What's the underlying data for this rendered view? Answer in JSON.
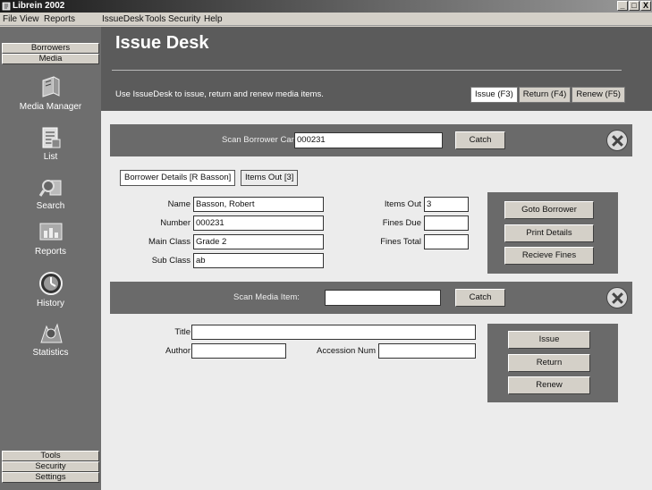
{
  "window": {
    "title": "Librein 2002",
    "minimize_glyph": "_",
    "maximize_glyph": "□",
    "close_glyph": "X"
  },
  "menubar": [
    "File",
    "View",
    "Reports",
    "IssueDesk",
    "Tools",
    "Security",
    "Help"
  ],
  "sidebar": {
    "top_groups": [
      "Borrowers",
      "Media"
    ],
    "items": [
      {
        "label": "Media Manager",
        "icon": "media-manager-icon"
      },
      {
        "label": "List",
        "icon": "list-icon"
      },
      {
        "label": "Search",
        "icon": "search-icon"
      },
      {
        "label": "Reports",
        "icon": "reports-icon"
      },
      {
        "label": "History",
        "icon": "history-icon"
      },
      {
        "label": "Statistics",
        "icon": "statistics-icon"
      }
    ],
    "bottom_groups": [
      "Tools",
      "Security",
      "Settings"
    ]
  },
  "header": {
    "title": "Issue Desk",
    "subtitle": "Use IssueDesk to issue, return and renew media items.",
    "tabs": [
      "Issue (F3)",
      "Return (F4)",
      "Renew (F5)"
    ],
    "active_tab": "Issue (F3)"
  },
  "borrower_scan": {
    "label": "Scan Borrower Card:",
    "value": "000231",
    "catch_label": "Catch"
  },
  "borrower_tabs": [
    "Borrower Details [R Basson]",
    "Items Out [3]"
  ],
  "borrower": {
    "name_label": "Name",
    "name": "Basson, Robert",
    "number_label": "Number",
    "number": "000231",
    "main_class_label": "Main Class",
    "main_class": "Grade 2",
    "sub_class_label": "Sub Class",
    "sub_class": "ab",
    "items_out_label": "Items Out",
    "items_out": "3",
    "fines_due_label": "Fines Due",
    "fines_due": "",
    "fines_total_label": "Fines Total",
    "fines_total": ""
  },
  "borrower_actions": [
    "Goto Borrower",
    "Print Details",
    "Recieve Fines"
  ],
  "media_scan": {
    "label": "Scan Media Item:",
    "value": "",
    "catch_label": "Catch"
  },
  "media": {
    "title_label": "Title",
    "title": "",
    "author_label": "Author",
    "author": "",
    "accession_label": "Accession Num",
    "accession": ""
  },
  "media_actions": [
    "Issue",
    "Return",
    "Renew"
  ],
  "colors": {
    "sidebar_bg": "#6e6e6e",
    "header_bg": "#5b5b5b",
    "band_bg": "#6a6a6a",
    "content_bg": "#ececec"
  }
}
